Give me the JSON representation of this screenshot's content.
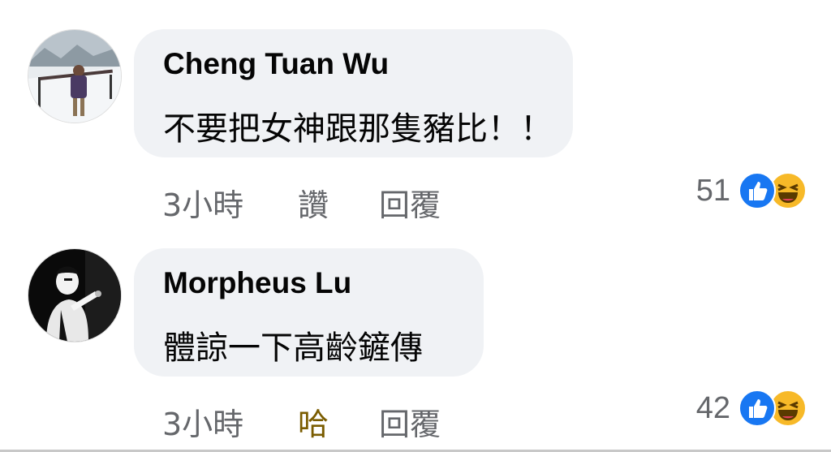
{
  "comments": [
    {
      "author": "Cheng Tuan Wu",
      "text": "不要把女神跟那隻豬比！！",
      "time": "3小時",
      "react_action": "讚",
      "reply": "回覆",
      "reaction_count": "51"
    },
    {
      "author": "Morpheus Lu",
      "text": "體諒一下高齡鏟傳",
      "time": "3小時",
      "react_action": "哈",
      "reply": "回覆",
      "reaction_count": "42"
    }
  ],
  "icons": {
    "like": "like-reaction-icon",
    "haha": "haha-reaction-icon"
  },
  "colors": {
    "bubble": "#f0f2f5",
    "meta_text": "#65676b",
    "like_blue": "#1877f2",
    "haha_yellow": "#f7b928",
    "haha_selected": "#7a5c00"
  }
}
